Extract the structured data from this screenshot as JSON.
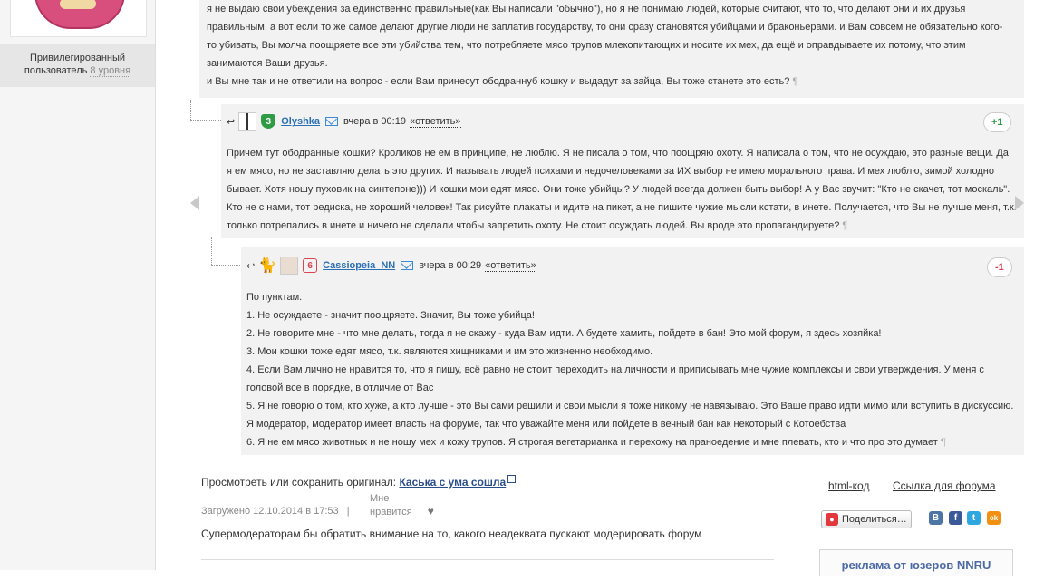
{
  "sidebar": {
    "user_status_line1": "Привилегированный",
    "user_status_line2": "пользователь",
    "user_level": "8 уровня"
  },
  "top_comment": {
    "lines": [
      "я не выдаю свои убеждения за единственно правильные(как Вы написали \"обычно\"), но я не понимаю людей, которые считают, что то, что делают они и их друзья",
      "правильным, а вот если то же самое делают другие люди не заплатив государству, то они сразу становятся убийцами и браконьерами. и Вам совсем не обязательно кого-",
      "то убивать, Вы молча поощряете все эти убийства тем, что потребляете мясо трупов млекопитающих и носите их мех, да ещё и оправдываете их потому, что этим",
      "занимаются Ваши друзья.",
      "и Вы мне так и не ответили на вопрос - если Вам принесут ободраннуб кошку и выдадут за зайца, Вы тоже станете это есть?"
    ],
    "pilcrow": "¶"
  },
  "comment_olyshka": {
    "reply_arrow": "↩",
    "badge": "3",
    "username": "Olyshka",
    "time": "вчера в 00:19",
    "reply_label": "«ответить»",
    "score": "+1",
    "lines": [
      "Причем тут ободранные кошки? Кроликов не ем в принципе, не люблю. Я не писала о том, что поощряю охоту. Я написала о том, что не осуждаю, это разные вещи. Да",
      "я ем мясо, но не заставляю делать это других. И называть людей психами и недочеловеками за ИХ выбор не имею морального права. И мех люблю, зимой холодно",
      "бывает. Хотя ношу пуховик на синтепоне))) И кошки мои едят мясо. Они тоже убийцы? У людей всегда должен быть выбор! А у Вас звучит: \"Кто не скачет, тот москаль\".",
      "Кто не с нами, тот редиска, не хороший человек! Так рисуйте плакаты и идите на пикет, а не пишите чужие мысли кстати, в инете. Получается, что Вы не лучше меня, т.к.",
      "только потрепались в инете и ничего не сделали чтобы запретить охоту. Не стоит осуждать людей. Вы вроде это пропагандируете?"
    ],
    "pilcrow": "¶"
  },
  "comment_cassiopeia": {
    "reply_arrow": "↩",
    "badge": "6",
    "username": "Cassiopeia_NN",
    "time": "вчера в 00:29",
    "reply_label": "«ответить»",
    "score": "-1",
    "lines": [
      "По пунктам.",
      "1. Не осуждаете - значит поощряете. Значит, Вы тоже убийца!",
      "2. Не говорите мне - что мне делать, тогда я не скажу - куда Вам идти. А будете хамить, пойдете в бан! Это мой форум, я здесь хозяйка!",
      "3. Мои кошки тоже едят мясо, т.к. являются хищниками и им это жизненно необходимо.",
      "4. Если Вам лично не нравится то, что я пишу, всё равно не стоит переходить на личности и приписывать мне чужие комплексы и свои утверждения. У меня с",
      "головой все в порядке, в отличие от Вас",
      "5. Я не говорю о том, кто хуже, а кто лучше - это Вы сами решили и свои мысли я тоже никому не навязываю. Это Ваше право идти мимо или вступить в дискуссию.",
      "Я модератор, модератор имеет власть на форуме, так что уважайте меня или пойдете в вечный бан как некоторый с Котоебства",
      "6. Я не ем мясо животных и не ношу мех и кожу трупов. Я строгая вегетарианка и перехожу на праноедение и мне плевать, кто и что про это думает"
    ],
    "pilcrow": "¶"
  },
  "footer": {
    "view_label": "Просмотреть или сохранить оригинал:",
    "original_link": "Каська с ума сошла",
    "uploaded": "Загружено 12.10.2014 в 17:53",
    "separator": "|",
    "like_line1": "Мне",
    "like_line2": "нравится",
    "heart": "♥",
    "description": "Супермодераторам бы обратить внимание на то, какого неадеквата пускают модерировать форум",
    "html_code": "html-код",
    "forum_link": "Ссылка для форума",
    "share_label": "Поделиться…",
    "social": [
      "В",
      "f",
      "t",
      "ok"
    ],
    "ad_title": "реклама от юзеров NNRU"
  },
  "colors": {
    "link_blue": "#2a6fb6",
    "positive": "#2f9b45",
    "negative": "#d9444e",
    "block_bg": "#f2f2f2"
  }
}
